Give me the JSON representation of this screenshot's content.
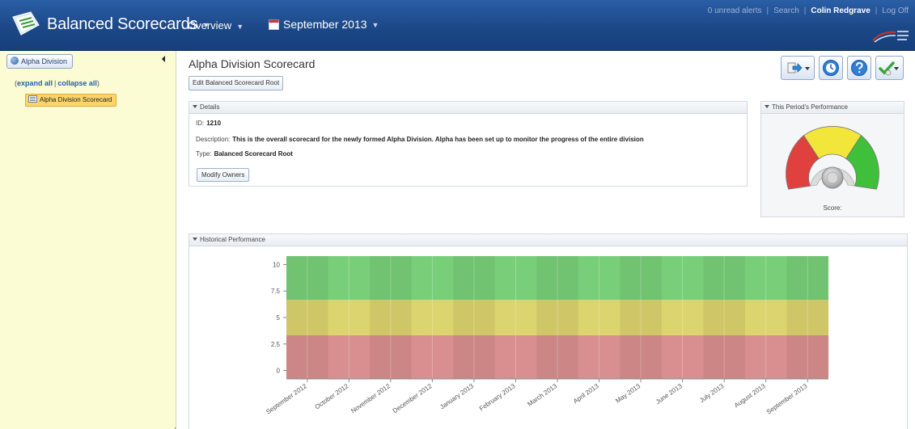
{
  "header": {
    "app_title": "Balanced Scorecards",
    "nav_overview": "Overview",
    "nav_period": "September 2013",
    "alerts": "0 unread alerts",
    "search": "Search",
    "user": "Colin Redgrave",
    "logoff": "Log Off",
    "colors": {
      "bar": "#1c4888",
      "accent": "#2a5ea6"
    }
  },
  "sidebar": {
    "division_button": "Alpha Division",
    "expand_all": "expand all",
    "collapse_all": "collapse all",
    "open_bracket": "(",
    "close_bracket": ")",
    "separator": "|",
    "tree_item": "Alpha Division Scorecard"
  },
  "main": {
    "title": "Alpha Division Scorecard",
    "edit_button": "Edit Balanced Scorecard Root",
    "toolbar_icons": [
      "export-icon",
      "history-icon",
      "help-icon",
      "approve-icon"
    ]
  },
  "details": {
    "header": "Details",
    "id_label": "ID:",
    "id_value": "1210",
    "description_label": "Description:",
    "description_value": "This is the overall scorecard for the newly formed Alpha Division. Alpha has been set up to monitor the progress of the entire division",
    "type_label": "Type:",
    "type_value": "Balanced Scorecard Root",
    "modify_owners": "Modify Owners"
  },
  "performance": {
    "header": "This Period's Performance",
    "score_label": "Score:",
    "gauge_colors": [
      "#e0413f",
      "#f2e63a",
      "#3fbf3a"
    ]
  },
  "history": {
    "header": "Historical Performance"
  },
  "chart_data": {
    "type": "heatmap",
    "title": "",
    "xlabel": "",
    "ylabel": "",
    "ylim": [
      -0.8,
      10.8
    ],
    "yticks": [
      "10",
      "7.5",
      "5",
      "2.5",
      "0"
    ],
    "ytick_values": [
      10,
      7.5,
      5,
      2.5,
      0
    ],
    "categories": [
      "September 2012",
      "October 2012",
      "November 2012",
      "December 2012",
      "January 2013",
      "February 2013",
      "March 2013",
      "April 2013",
      "May 2013",
      "June 2013",
      "July 2013",
      "August 2013",
      "September 2013"
    ],
    "bands": [
      {
        "name": "red",
        "from": -0.8,
        "to": 3.33,
        "color": "#d98f8f"
      },
      {
        "name": "yellow",
        "from": 3.33,
        "to": 6.67,
        "color": "#dcd46e"
      },
      {
        "name": "green",
        "from": 6.67,
        "to": 10.8,
        "color": "#79cf79"
      }
    ],
    "series": [],
    "grid": true
  }
}
